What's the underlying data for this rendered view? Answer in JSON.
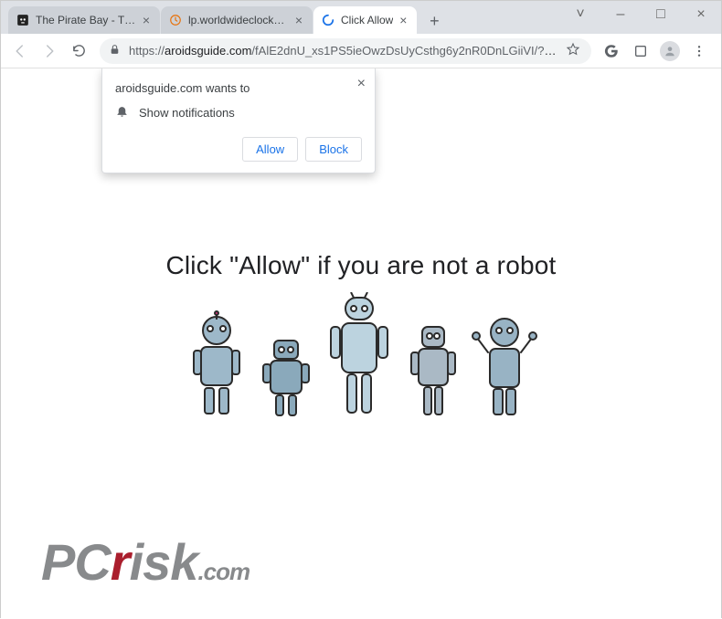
{
  "window": {
    "tabs": [
      {
        "title": "The Pirate Bay - The gal...",
        "active": false
      },
      {
        "title": "lp.worldwideclockextens...",
        "active": false
      },
      {
        "title": "Click Allow",
        "active": true
      }
    ],
    "controls": {
      "drop": "˅",
      "min": "–",
      "max": "□",
      "close": "×"
    },
    "newtab": "+"
  },
  "toolbar": {
    "url_proto": "https://",
    "url_host": "aroidsguide.com",
    "url_path": "/fAlE2dnU_xs1PS5ieOwzDsUyCsthg6y2nR0DnLGiiVI/?cid..."
  },
  "permission": {
    "title": "aroidsguide.com wants to",
    "option": "Show notifications",
    "allow": "Allow",
    "block": "Block"
  },
  "page": {
    "message": "Click \"Allow\"   if you are not   a robot"
  },
  "watermark": {
    "p1": "PC",
    "p2": "r",
    "p3": "isk",
    "ext": ".com"
  }
}
